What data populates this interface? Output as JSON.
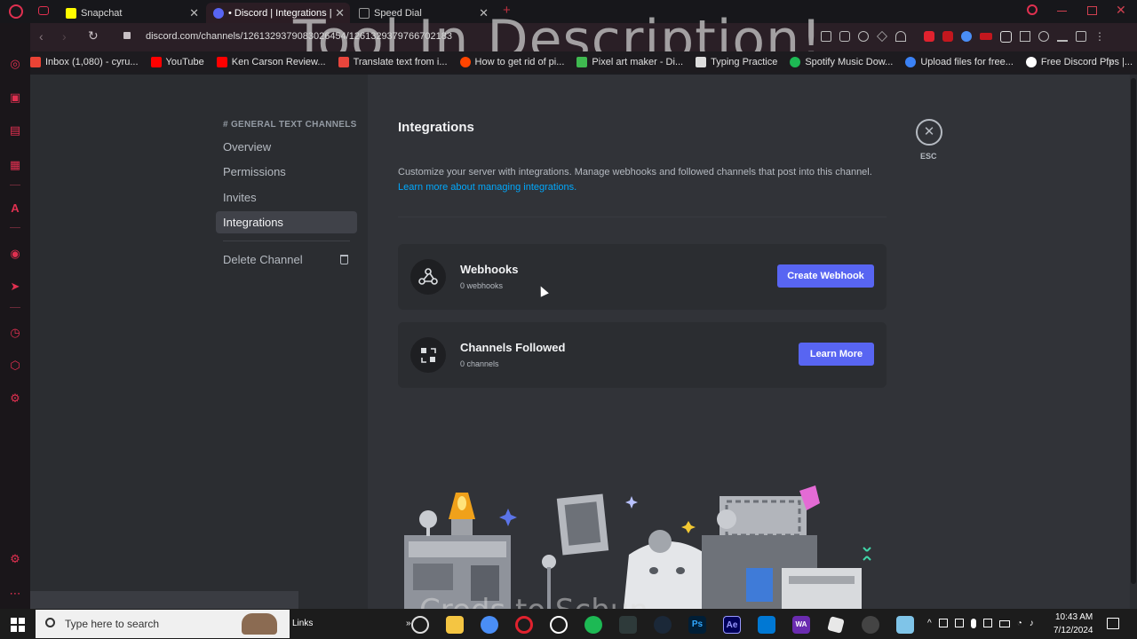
{
  "tabs": [
    {
      "label": "Snapchat",
      "color": "#fffc00"
    },
    {
      "label": "• Discord | Integrations | To",
      "color": "#5865f2"
    },
    {
      "label": "Speed Dial",
      "color": "#888888"
    }
  ],
  "address": {
    "url": "discord.com/channels/1261329379083026454/1261329379766702183"
  },
  "watermark": "Tool In Description!",
  "bookmarks": [
    {
      "label": "Inbox (1,080) - cyru...",
      "color": "#ea4335"
    },
    {
      "label": "YouTube",
      "color": "#ff0000"
    },
    {
      "label": "Ken Carson Review...",
      "color": "#ff0000"
    },
    {
      "label": "Translate text from i...",
      "color": "#e8453c"
    },
    {
      "label": "How to get rid of pi...",
      "color": "#ff4500"
    },
    {
      "label": "Pixel art maker - Di...",
      "color": "#3fb950"
    },
    {
      "label": "Typing Practice",
      "color": "#dddddd"
    },
    {
      "label": "Spotify Music Dow...",
      "color": "#1db954"
    },
    {
      "label": "Upload files for free...",
      "color": "#3b82f6"
    },
    {
      "label": "Free Discord Pfps |...",
      "color": "#ffffff"
    }
  ],
  "sidebar": {
    "category": "# GENERAL TEXT CHANNELS",
    "items": [
      "Overview",
      "Permissions",
      "Invites",
      "Integrations"
    ],
    "delete": "Delete Channel"
  },
  "main": {
    "title": "Integrations",
    "description": "Customize your server with integrations. Manage webhooks and followed channels that post into this channel.",
    "learn_link": "Learn more about managing integrations.",
    "esc": "ESC",
    "webhooks": {
      "title": "Webhooks",
      "sub": "0 webhooks",
      "button": "Create Webhook"
    },
    "channels": {
      "title": "Channels Followed",
      "sub": "0 channels",
      "button": "Learn More"
    }
  },
  "caption": "Creds to Schun",
  "taskbar": {
    "search_placeholder": "Type here to search",
    "links": "Links",
    "time": "10:43 AM",
    "date": "7/12/2024"
  },
  "colors": {
    "accent": "#5865f2",
    "link": "#00a8fc",
    "opera": "#e03050"
  }
}
